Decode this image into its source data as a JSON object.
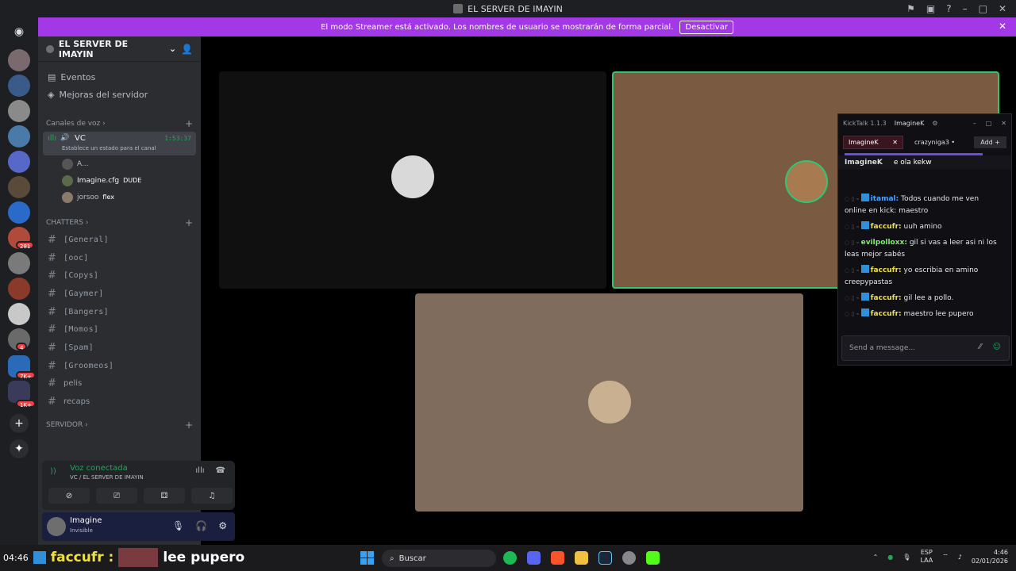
{
  "window": {
    "title": "EL SERVER DE IMAYIN"
  },
  "banner": {
    "text": "El modo Streamer está activado. Los nombres de usuario se mostrarán de forma parcial.",
    "button": "Desactivar"
  },
  "rail": {
    "badges": [
      "281",
      "4",
      "7K+",
      "1K+"
    ]
  },
  "server": {
    "name": "EL SERVER DE IMAYIN",
    "nav": [
      {
        "label": "Eventos"
      },
      {
        "label": "Mejoras del servidor"
      }
    ],
    "voice_category": "Canales de voz",
    "vc": {
      "name": "VC",
      "timer": "1:53:37",
      "status": "Establece un estado para el canal"
    },
    "voice_users": [
      {
        "name": "A...",
        "tag": ""
      },
      {
        "name": "Imagine.cfg",
        "tag": "DUDE"
      },
      {
        "name": "jorsoo",
        "tag": "flex"
      }
    ],
    "text_category": "CHATTERS",
    "channels": [
      {
        "name": "[General]"
      },
      {
        "name": "[ooc]"
      },
      {
        "name": "[Copys]"
      },
      {
        "name": "[Gaymer]"
      },
      {
        "name": "[Bangers]"
      },
      {
        "name": "[Momos]"
      },
      {
        "name": "[Spam]"
      },
      {
        "name": "[Groomeos]"
      },
      {
        "name": "pelis"
      },
      {
        "name": "recaps"
      }
    ],
    "server_category": "SERVIDOR"
  },
  "voice_status": {
    "title": "Voz conectada",
    "subtitle": "VC / EL SERVER DE IMAYIN"
  },
  "user": {
    "name": "Imagine",
    "status": "Invisible"
  },
  "kicktalk": {
    "app": "KickTalk 1.1.3",
    "account": "ImagineK",
    "tabs": [
      {
        "label": "ImagineK"
      },
      {
        "label": "crazyniga3"
      }
    ],
    "add_label": "Add",
    "pinned_user": "ImagineK",
    "pinned_text": "e ola kekw",
    "messages": [
      {
        "user": "itamal:",
        "text": "Todos cuando me ven online en kick: maestro",
        "color": "#4aa3ff"
      },
      {
        "user": "faccufr:",
        "text": "uuh amino",
        "color": "#f0e040"
      },
      {
        "user": "evilpolloxx:",
        "text": "gil si vas a leer asi ni los leas mejor sabés",
        "color": "#7cf06a"
      },
      {
        "user": "faccufr:",
        "text": "yo escribia en amino creepypastas",
        "color": "#f0e040"
      },
      {
        "user": "faccufr:",
        "text": "gil lee a pollo.",
        "color": "#f0e040"
      },
      {
        "user": "faccufr:",
        "text": "maestro lee pupero",
        "color": "#f0e040"
      }
    ],
    "input_placeholder": "Send a message..."
  },
  "taskbar": {
    "chat_time": "04:46",
    "chat_user": "faccufr :",
    "chat_text": "lee pupero",
    "search": "Buscar",
    "lang": "ESP",
    "region": "LAA",
    "time": "4:46",
    "date": "02/01/2026"
  },
  "colors": {
    "streamer_banner": "#a238e6",
    "voice_green": "#23a559",
    "kick_green": "#53fc18"
  }
}
